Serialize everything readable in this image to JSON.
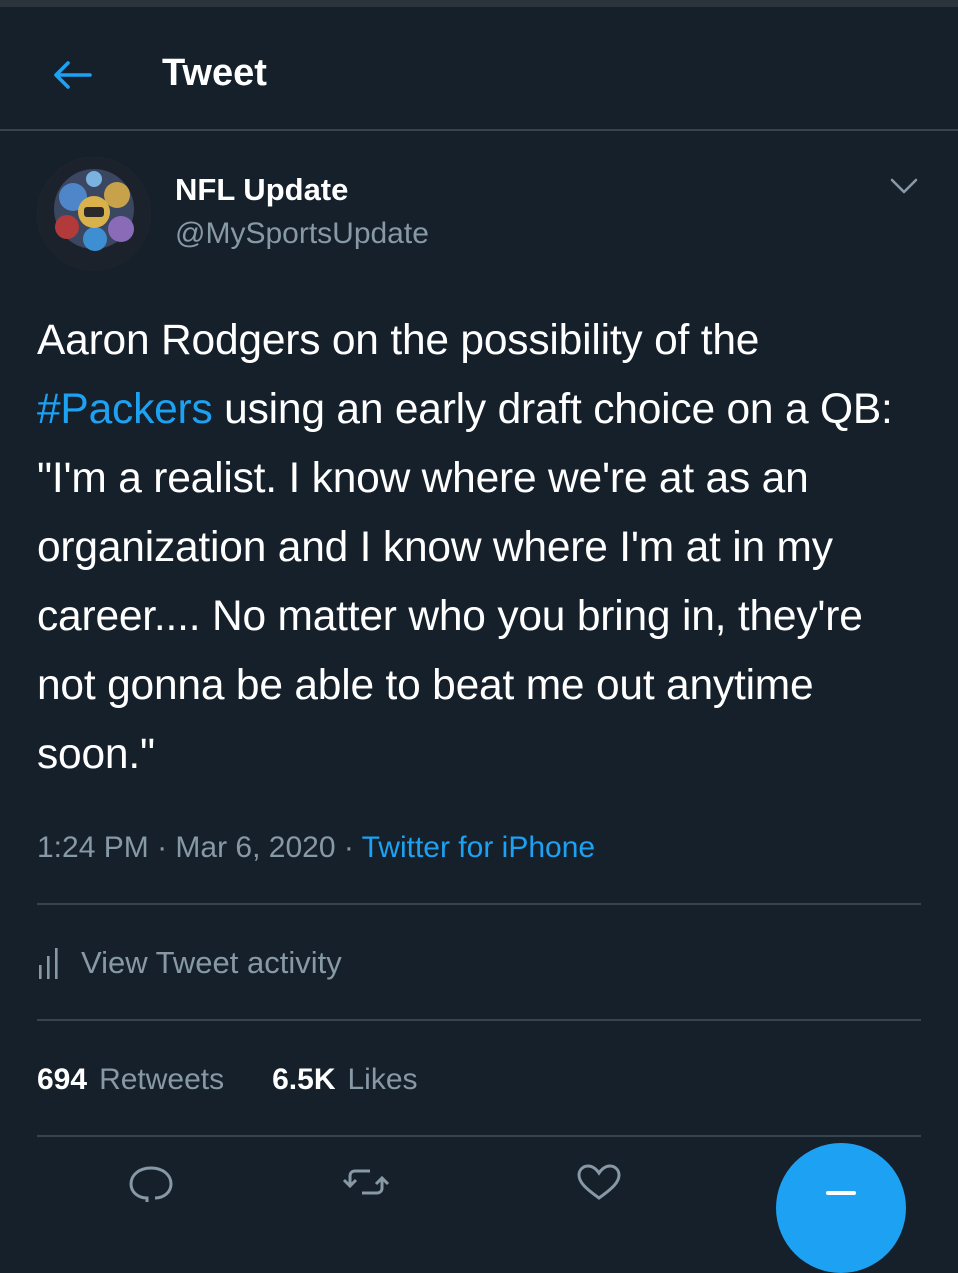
{
  "header": {
    "title": "Tweet"
  },
  "author": {
    "name": "NFL Update",
    "handle": "@MySportsUpdate"
  },
  "tweet": {
    "text_before": "Aaron Rodgers on the possibility of the ",
    "hashtag": "#Packers",
    "text_after": " using an early draft choice on a QB: \"I'm a realist. I know where we're at as an organization and I know where I'm at in my career.... No matter who you bring in, they're not gonna be able to beat me out anytime soon.\"",
    "time": "1:24 PM",
    "date": "Mar 6, 2020",
    "source": "Twitter for iPhone"
  },
  "activity": {
    "label": "View Tweet activity"
  },
  "stats": {
    "retweets_count": "694",
    "retweets_label": "Retweets",
    "likes_count": "6.5K",
    "likes_label": "Likes"
  },
  "colors": {
    "background": "#15202b",
    "accent": "#1da1f2",
    "secondary_text": "#8899a6",
    "divider": "#38444d"
  },
  "icons": {
    "back": "back-arrow-icon",
    "caret": "chevron-down-icon",
    "activity": "bar-chart-icon",
    "reply": "reply-icon",
    "retweet": "retweet-icon",
    "like": "heart-icon",
    "compose": "compose-icon"
  }
}
